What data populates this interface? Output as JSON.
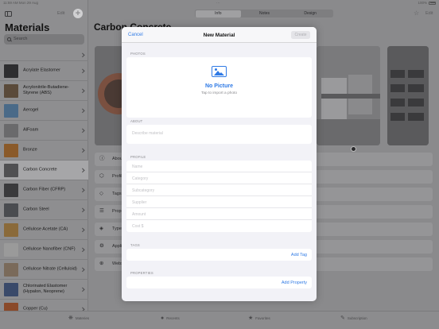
{
  "status_bar": {
    "time": "11:59 AM   Mon 29 Aug",
    "battery": "100%"
  },
  "sidebar": {
    "edit_label": "Edit",
    "add_label": "+",
    "title": "Materials",
    "search_placeholder": "Search",
    "items": [
      {
        "label": "Acrylate Elastomer",
        "thumb": "#2e2e30"
      },
      {
        "label": "Acrylonitrile-Butadiene-Styrene (ABS)",
        "thumb": "#5a4a3a"
      },
      {
        "label": "Aerogel",
        "thumb": "#4a6a88"
      },
      {
        "label": "AlFoam",
        "thumb": "#6a6a6c"
      },
      {
        "label": "Bronze",
        "thumb": "#8a5a2a"
      },
      {
        "label": "Carbon Concrete",
        "thumb": "#505052"
      },
      {
        "label": "Carbon Fiber (CFRP)",
        "thumb": "#3a3a3c"
      },
      {
        "label": "Carbon Steel",
        "thumb": "#4a4c50"
      },
      {
        "label": "Cellulose Acetate (CA)",
        "thumb": "#8a6a3a"
      },
      {
        "label": "Cellulose Nanofiber (CNF)",
        "thumb": "#9a9a9a"
      },
      {
        "label": "Cellulose Nitrate (Celluloid)",
        "thumb": "#7a6a5a"
      },
      {
        "label": "Chlorinated Elastomer (Hypalon, Neoprene)",
        "thumb": "#3a4a6a"
      },
      {
        "label": "Copper (Cu)",
        "thumb": "#8a4a2a"
      }
    ],
    "active_index": 5
  },
  "main": {
    "tabs": [
      "Info",
      "Notes",
      "Design"
    ],
    "selected_tab": "Info",
    "edit_label": "Edit",
    "title": "Carbon Concrete",
    "rows": [
      {
        "icon": "ⓘ",
        "label": "About"
      },
      {
        "icon": "⬡",
        "label": "Profile"
      },
      {
        "icon": "◇",
        "label": "Tags"
      },
      {
        "icon": "☰",
        "label": "Properties"
      },
      {
        "icon": "◈",
        "label": "Type"
      },
      {
        "icon": "⚙",
        "label": "Applications"
      },
      {
        "icon": "⊕",
        "label": "Websites"
      }
    ]
  },
  "tabbar": [
    {
      "icon": "❋",
      "label": "Materies"
    },
    {
      "icon": "●",
      "label": "Recents"
    },
    {
      "icon": "★",
      "label": "Favorites"
    },
    {
      "icon": "✎",
      "label": "Subscription"
    }
  ],
  "modal": {
    "cancel": "Cancel",
    "title": "New Material",
    "create": "Create",
    "photos_header": "PHOTOS",
    "no_picture": "No Picture",
    "tap_hint": "Tap to import a photo",
    "about_header": "ABOUT",
    "about_placeholder": "Describe material",
    "profile_header": "PROFILE",
    "profile_fields": [
      "Name",
      "Category",
      "Subcategory",
      "Supplier",
      "Amount",
      "Cost $"
    ],
    "tags_header": "TAGS",
    "add_tag": "Add Tag",
    "properties_header": "PROPERTIES",
    "add_property": "Add Property"
  }
}
